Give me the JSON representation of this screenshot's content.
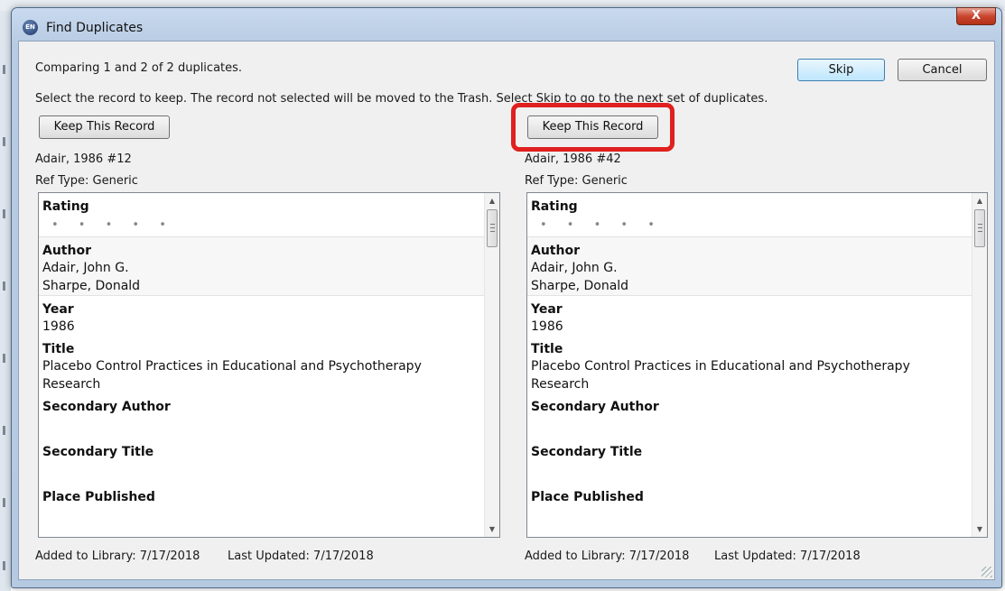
{
  "window": {
    "title": "Find Duplicates",
    "app_icon": "endnote-icon",
    "close_glyph": "X"
  },
  "header": {
    "comparing": "Comparing 1 and 2 of 2 duplicates.",
    "instructions": "Select the record to keep. The record not selected will be moved to the Trash. Select Skip to go to the next set of duplicates.",
    "skip_label": "Skip",
    "cancel_label": "Cancel"
  },
  "records": [
    {
      "keep_label": "Keep This Record",
      "label": "Adair, 1986 #12",
      "ref_type": "Ref Type: Generic",
      "fields": {
        "rating_label": "Rating",
        "rating_dots": "• • • • •",
        "author_label": "Author",
        "authors": [
          "Adair, John G.",
          "Sharpe, Donald"
        ],
        "year_label": "Year",
        "year": "1986",
        "title_label": "Title",
        "title_line1": "Placebo Control Practices in Educational and Psychotherapy",
        "title_line2": "Research",
        "secondary_author_label": "Secondary Author",
        "secondary_title_label": "Secondary Title",
        "place_published_label": "Place Published"
      },
      "added": "Added to Library: 7/17/2018",
      "updated": "Last Updated: 7/17/2018"
    },
    {
      "keep_label": "Keep This Record",
      "label": "Adair, 1986 #42",
      "ref_type": "Ref Type: Generic",
      "fields": {
        "rating_label": "Rating",
        "rating_dots": "• • • • •",
        "author_label": "Author",
        "authors": [
          "Adair, John G.",
          "Sharpe, Donald"
        ],
        "year_label": "Year",
        "year": "1986",
        "title_label": "Title",
        "title_line1": "Placebo Control Practices in Educational and Psychotherapy",
        "title_line2": "Research",
        "secondary_author_label": "Secondary Author",
        "secondary_title_label": "Secondary Title",
        "place_published_label": "Place Published"
      },
      "added": "Added to Library: 7/17/2018",
      "updated": "Last Updated: 7/17/2018"
    }
  ],
  "colors": {
    "highlight": "#e0201f",
    "client_bg": "#f0f0f0",
    "window_frame": "#b7cbe3"
  }
}
